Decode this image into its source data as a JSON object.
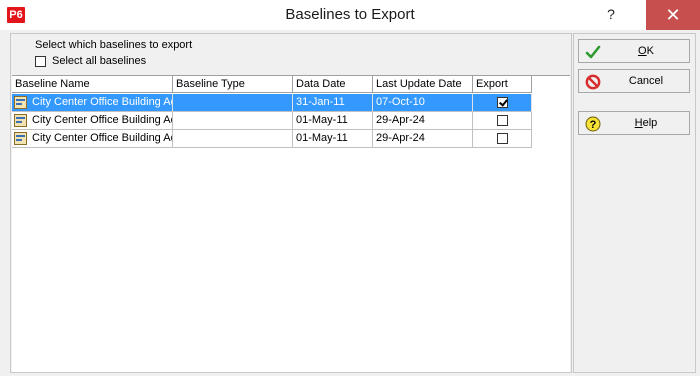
{
  "window": {
    "app_icon_label": "P6",
    "title": "Baselines to Export",
    "help_glyph": "?",
    "close_glyph": "✕"
  },
  "left": {
    "prompt": "Select which baselines to export",
    "select_all_label": "Select all baselines",
    "select_all_checked": false
  },
  "table": {
    "columns": [
      "Baseline Name",
      "Baseline Type",
      "Data Date",
      "Last Update Date",
      "Export"
    ],
    "rows": [
      {
        "name": "City Center Office Building Ad",
        "type": "",
        "data_date": "31-Jan-11",
        "last_update": "07-Oct-10",
        "export": true
      },
      {
        "name": "City Center Office Building Ad",
        "type": "",
        "data_date": "01-May-11",
        "last_update": "29-Apr-24",
        "export": false
      },
      {
        "name": "City Center Office Building Ad",
        "type": "",
        "data_date": "01-May-11",
        "last_update": "29-Apr-24",
        "export": false
      }
    ]
  },
  "buttons": {
    "ok": {
      "first": "O",
      "rest": "K"
    },
    "cancel": {
      "first": "",
      "rest": "Cancel"
    },
    "help": {
      "first": "H",
      "rest": "elp"
    }
  },
  "colors": {
    "selection": "#3399ff",
    "close_button": "#c7504f",
    "app_icon": "#e3151a"
  }
}
